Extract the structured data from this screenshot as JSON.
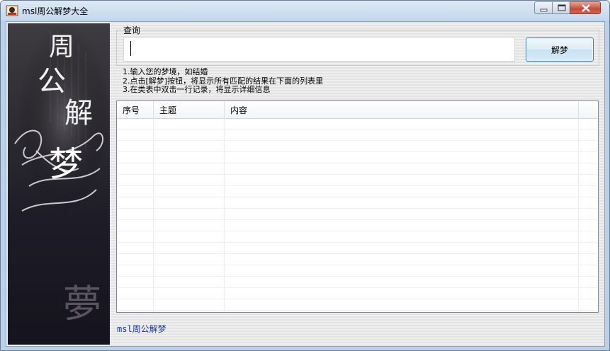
{
  "window": {
    "title": "msl周公解梦大全"
  },
  "banner": {
    "title_chars": [
      "周",
      "公",
      "解",
      "梦"
    ],
    "seal_char": "夢"
  },
  "query": {
    "group_label": "查询",
    "input_value": "",
    "button_label": "解梦"
  },
  "instructions": [
    "1.输入您的梦境，如结婚",
    "2.点击[解梦]按钮，将显示所有匹配的结果在下面的列表里",
    "3.在类表中双击一行记录，将显示详细信息"
  ],
  "results_table": {
    "columns": [
      "序号",
      "主题",
      "内容"
    ],
    "rows": []
  },
  "footer": {
    "text": "msl周公解梦"
  },
  "colors": {
    "titlebar": "#c4d8ee",
    "close_button": "#c74a36",
    "footer_text": "#1a3c9a",
    "banner_bg": "#14121c"
  }
}
